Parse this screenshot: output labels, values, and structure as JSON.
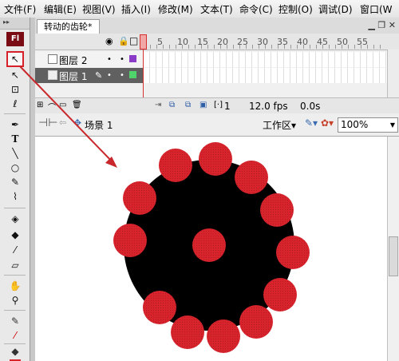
{
  "menu": [
    "文件(F)",
    "编辑(E)",
    "视图(V)",
    "插入(I)",
    "修改(M)",
    "文本(T)",
    "命令(C)",
    "控制(O)",
    "调试(D)",
    "窗口(W"
  ],
  "toolbox": {
    "logo": "Fl",
    "grip": "▸▸",
    "tools": [
      {
        "name": "selection-tool",
        "glyph": "↖"
      },
      {
        "name": "subselection-tool",
        "glyph": "↖"
      },
      {
        "name": "free-transform-tool",
        "glyph": "⊡"
      },
      {
        "name": "lasso-tool",
        "glyph": "ℓ"
      },
      {
        "name": "pen-tool",
        "glyph": "✒"
      },
      {
        "name": "text-tool",
        "glyph": "T"
      },
      {
        "name": "line-tool",
        "glyph": "╲"
      },
      {
        "name": "oval-tool",
        "glyph": "○"
      },
      {
        "name": "pencil-tool",
        "glyph": "✎"
      },
      {
        "name": "brush-tool",
        "glyph": "⌇"
      },
      {
        "name": "ink-bottle-tool",
        "glyph": "◈"
      },
      {
        "name": "paint-bucket-tool",
        "glyph": "◆"
      },
      {
        "name": "eyedropper-tool",
        "glyph": "⁄"
      },
      {
        "name": "eraser-tool",
        "glyph": "▱"
      },
      {
        "name": "hand-tool",
        "glyph": "✋"
      },
      {
        "name": "zoom-tool",
        "glyph": "⚲"
      },
      {
        "name": "stroke-color-tool",
        "glyph": "✎"
      },
      {
        "name": "swap-colors-tool",
        "glyph": "⁄"
      },
      {
        "name": "fill-color-tool",
        "glyph": "◆"
      }
    ]
  },
  "document_tab": {
    "title": "转动的齿轮*"
  },
  "timeline": {
    "frame_numbers": [
      "5",
      "10",
      "15",
      "20",
      "25",
      "30",
      "35",
      "40",
      "45",
      "50",
      "55"
    ],
    "layers": [
      {
        "name": "图层 2",
        "color": "#8a3cc8"
      },
      {
        "name": "图层 1",
        "color": "#4fd36b"
      }
    ],
    "current_frame": "1",
    "fps": "12.0 fps",
    "time": "0.0s"
  },
  "editbar": {
    "scene": "场景 1",
    "workspace": "工作区▾",
    "zoom": "100%"
  },
  "colors": {
    "gear_body": "#000000",
    "gear_teeth": "#d6232c",
    "arrow": "#c8282c",
    "highlight": "#d6202a"
  }
}
